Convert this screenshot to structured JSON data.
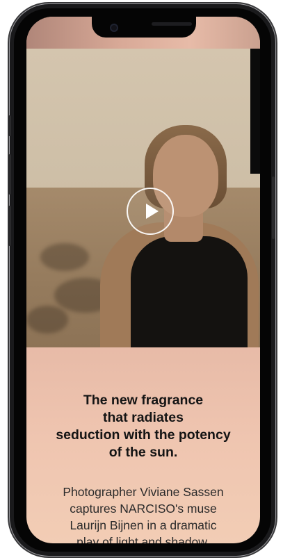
{
  "video": {
    "play_icon": "play-icon"
  },
  "content": {
    "headline_lines": [
      "The new fragrance",
      "that radiates",
      "seduction with the potency",
      "of the sun."
    ],
    "body_lines": [
      "Photographer Viviane Sassen",
      "captures NARCISO's muse",
      "Laurijn Bijnen in a dramatic",
      "play of light and shadow."
    ]
  },
  "colors": {
    "sunset_top": "#c89a88",
    "sunset_bottom": "#f2cdb5",
    "text_dark": "#141414"
  }
}
